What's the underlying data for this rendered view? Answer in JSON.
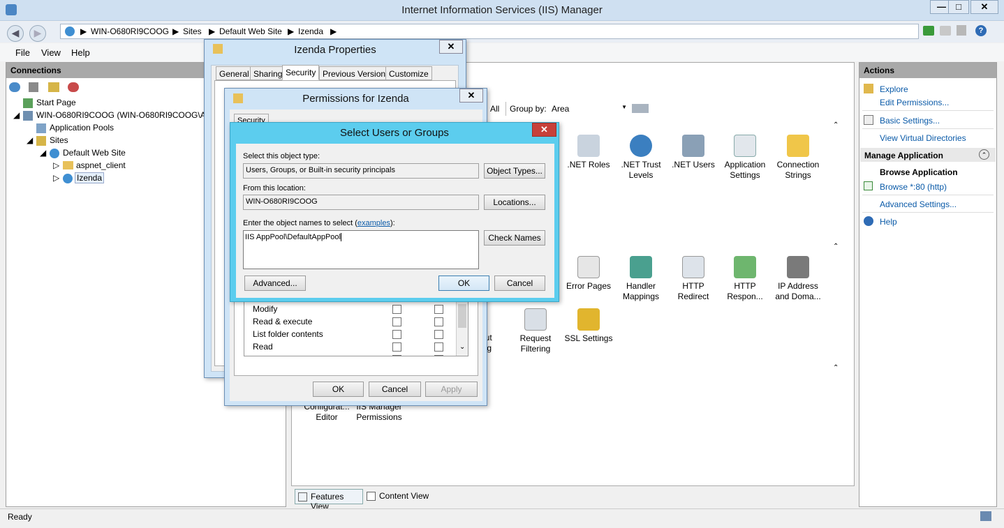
{
  "window": {
    "title": "Internet Information Services (IIS) Manager",
    "min": "—",
    "max": "□",
    "close": "✕"
  },
  "address": {
    "crumbs": [
      "WIN-O680RI9COOG",
      "Sites",
      "Default Web Site",
      "Izenda"
    ],
    "sep": "▶"
  },
  "menu": {
    "file": "File",
    "view": "View",
    "help": "Help"
  },
  "connections": {
    "title": "Connections",
    "tree": [
      "Start Page",
      "WIN-O680RI9COOG (WIN-O680RI9COOG\\Adm",
      "Application Pools",
      "Sites",
      "Default Web Site",
      "aspnet_client",
      "Izenda"
    ]
  },
  "center": {
    "show_all": "All",
    "group_by_label": "Group by:",
    "group_by_value": "Area",
    "features": [
      ".NET Roles",
      ".NET Trust Levels",
      ".NET Users",
      "Application Settings",
      "Connection Strings",
      "Error Pages",
      "Handler Mappings",
      "HTTP Redirect",
      "HTTP Respon...",
      "IP Address and Doma...",
      "out ing",
      "Request Filtering",
      "SSL Settings",
      "Configurat... Editor",
      "IIS Manager Permissions"
    ],
    "features_view": "Features View",
    "content_view": "Content View"
  },
  "actions": {
    "title": "Actions",
    "explore": "Explore",
    "edit_permissions": "Edit Permissions...",
    "basic_settings": "Basic Settings...",
    "view_virtual_dirs": "View Virtual Directories",
    "manage_app": "Manage Application",
    "browse_app": "Browse Application",
    "browse_80": "Browse *:80 (http)",
    "advanced_settings": "Advanced Settings...",
    "help": "Help"
  },
  "status": {
    "text": "Ready"
  },
  "props_dialog": {
    "title": "Izenda Properties",
    "tabs": [
      "General",
      "Sharing",
      "Security",
      "Previous Versions",
      "Customize"
    ]
  },
  "perm_dialog": {
    "title": "Permissions for Izenda",
    "tab": "Security",
    "rows": [
      "Modify",
      "Read & execute",
      "List folder contents",
      "Read"
    ],
    "ok": "OK",
    "cancel": "Cancel",
    "apply": "Apply"
  },
  "select_dialog": {
    "title": "Select Users or Groups",
    "object_type_label": "Select this object type:",
    "object_type_value": "Users, Groups, or Built-in security principals",
    "object_types_btn": "Object Types...",
    "location_label": "From this location:",
    "location_value": "WIN-O680RI9COOG",
    "locations_btn": "Locations...",
    "names_label_pre": "Enter the object names to select (",
    "names_label_link": "examples",
    "names_label_post": "):",
    "names_value": "IIS AppPool\\DefaultAppPool",
    "check_names_btn": "Check Names",
    "advanced_btn": "Advanced...",
    "ok": "OK",
    "cancel": "Cancel"
  },
  "colors": {
    "accent": "#5ccdee",
    "close_red": "#c7403a",
    "link": "#0a5aa8"
  }
}
